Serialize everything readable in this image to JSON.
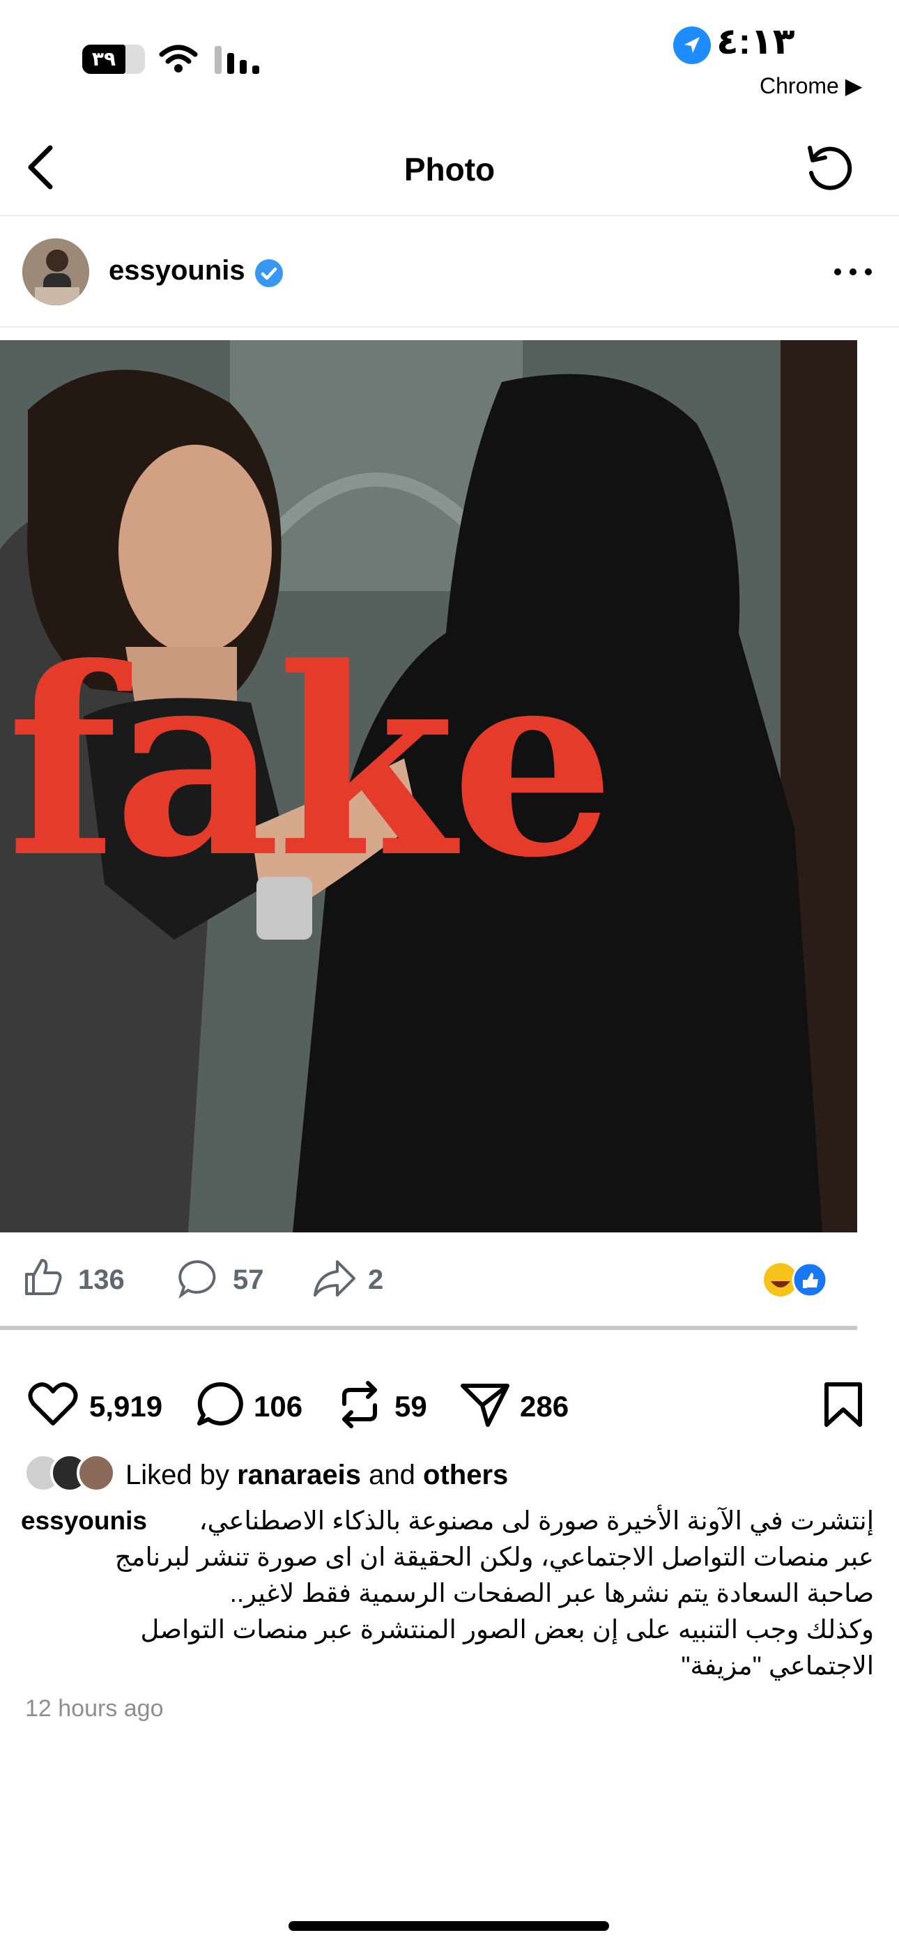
{
  "status_bar": {
    "time": "٤:١٣",
    "battery": "٣٩",
    "back_app": "Chrome ▶"
  },
  "header": {
    "title": "Photo"
  },
  "post": {
    "username": "essyounis",
    "image_overlay_text": "fake",
    "embedded_reactions": {
      "likes": "136",
      "comments": "57",
      "shares": "2"
    },
    "actions": {
      "likes": "5,919",
      "comments": "106",
      "reposts": "59",
      "shares": "286"
    },
    "liked_by": {
      "prefix": "Liked by",
      "user": "ranaraeis",
      "and": "and",
      "others": "others"
    },
    "caption": {
      "username": "essyounis",
      "line1": "إنتشرت في الآونة الأخيرة صورة لى مصنوعة بالذكاء الاصطناعي،",
      "line2": "عبر منصات التواصل الاجتماعي، ولكن الحقيقة ان اى صورة تنشر لبرنامج",
      "line3": "صاحبة السعادة يتم نشرها عبر الصفحات الرسمية فقط لاغير..",
      "line4": "وكذلك وجب التنبيه على إن بعض الصور المنتشرة عبر منصات التواصل",
      "line5": "الاجتماعي \"مزيفة\""
    },
    "timestamp": "12 hours ago"
  },
  "colors": {
    "fake_red": "#e53b2a",
    "verified_blue": "#3897f0",
    "location_blue": "#1e8bff"
  }
}
